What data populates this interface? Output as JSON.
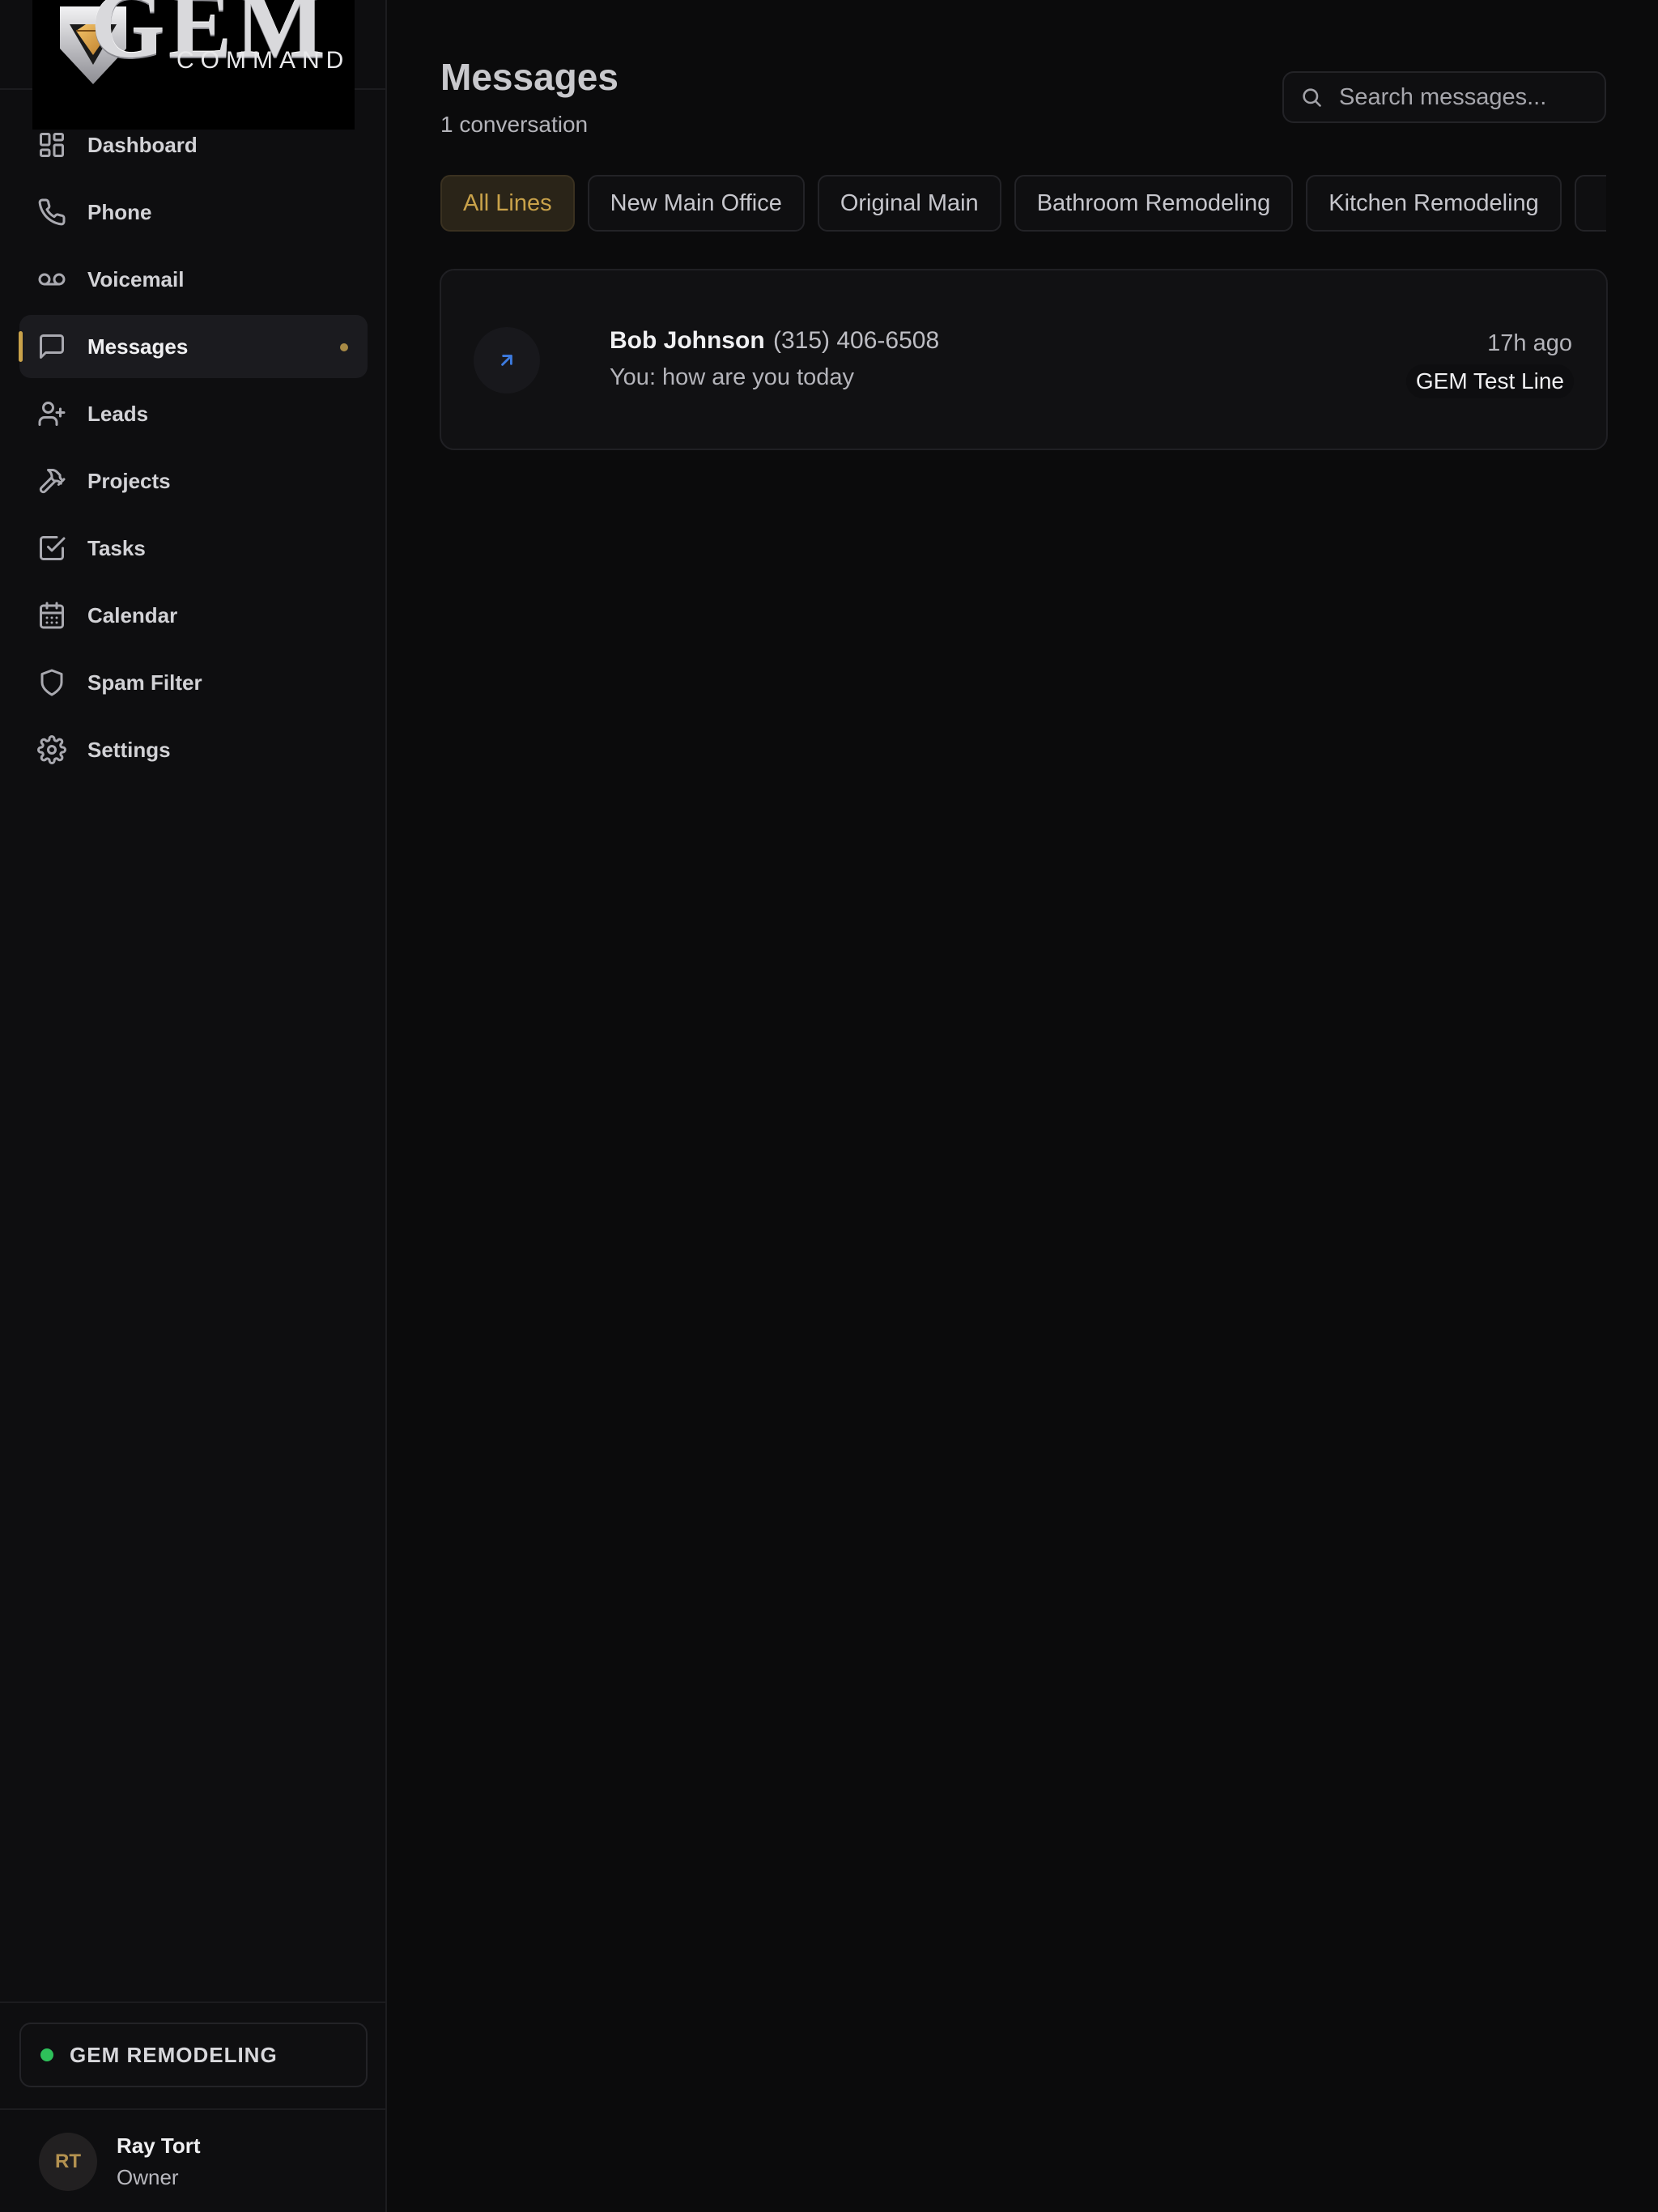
{
  "app": {
    "logo_main": "GEM",
    "logo_sub": "COMMAND"
  },
  "sidebar": {
    "items": [
      {
        "label": "Dashboard",
        "icon": "dashboard-icon"
      },
      {
        "label": "Phone",
        "icon": "phone-icon"
      },
      {
        "label": "Voicemail",
        "icon": "voicemail-icon"
      },
      {
        "label": "Messages",
        "icon": "message-icon",
        "active": true,
        "unread": true
      },
      {
        "label": "Leads",
        "icon": "user-plus-icon"
      },
      {
        "label": "Projects",
        "icon": "hammer-icon"
      },
      {
        "label": "Tasks",
        "icon": "checkbox-icon"
      },
      {
        "label": "Calendar",
        "icon": "calendar-icon"
      },
      {
        "label": "Spam Filter",
        "icon": "shield-icon"
      },
      {
        "label": "Settings",
        "icon": "gear-icon"
      }
    ],
    "org": {
      "name": "GEM REMODELING",
      "status_color": "#2ec05a"
    },
    "user": {
      "initials": "RT",
      "name": "Ray Tort",
      "role": "Owner"
    }
  },
  "main": {
    "title": "Messages",
    "subtitle": "1 conversation",
    "search": {
      "placeholder": "Search messages..."
    },
    "tabs": [
      {
        "label": "All Lines",
        "active": true
      },
      {
        "label": "New Main Office"
      },
      {
        "label": "Original Main"
      },
      {
        "label": "Bathroom Remodeling"
      },
      {
        "label": "Kitchen Remodeling"
      },
      {
        "label": ""
      }
    ],
    "conversations": [
      {
        "name": "Bob Johnson",
        "phone": "(315) 406-6508",
        "preview": "You: how are you today",
        "time": "17h ago",
        "line": "GEM Test Line",
        "direction": "outgoing"
      }
    ]
  },
  "colors": {
    "accent": "#c9a24a",
    "background": "#0b0b0c",
    "online": "#2ec05a",
    "outgoing_arrow": "#3d7be0"
  }
}
